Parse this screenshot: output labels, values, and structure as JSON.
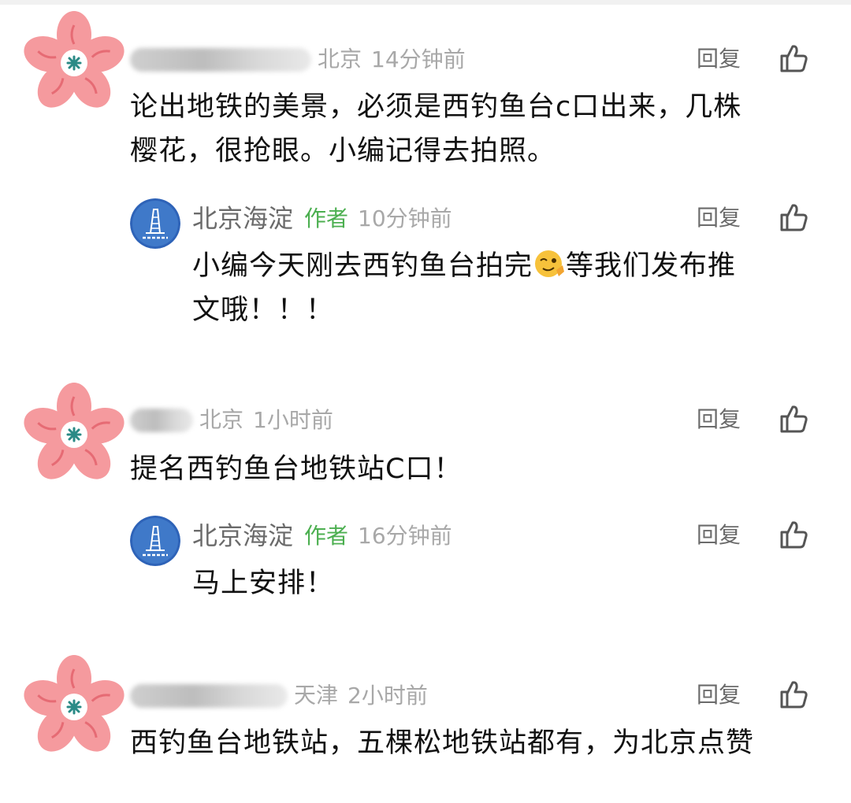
{
  "comments": [
    {
      "location": "北京",
      "time": "14分钟前",
      "text_line1": "论出地铁的美景，必须是西钓鱼台c口出来，几株",
      "text_line2": "樱花，很抢眼。小编记得去拍照。",
      "reply_label": "回复",
      "reply": {
        "name": "北京海淀",
        "tag": "作者",
        "time": "10分钟前",
        "text_line1a": "小编今天刚去西钓鱼台拍完",
        "emoji": "winking-face-emoji",
        "text_line1b": "等我们发布推",
        "text_line2": "文哦！！！",
        "reply_label": "回复"
      }
    },
    {
      "location": "北京",
      "time": "1小时前",
      "text": "提名西钓鱼台地铁站C口！",
      "reply_label": "回复",
      "reply": {
        "name": "北京海淀",
        "tag": "作者",
        "time": "16分钟前",
        "text": "马上安排！",
        "reply_label": "回复"
      }
    },
    {
      "location": "天津",
      "time": "2小时前",
      "text": "西钓鱼台地铁站，五棵松地铁站都有，为北京点赞",
      "reply_label": "回复"
    }
  ],
  "icons": {
    "like": "thumbs-up-icon",
    "avatar": "pink-flower-avatar",
    "author_avatar": "haidian-logo-avatar"
  },
  "colors": {
    "author_tag": "#4caf50",
    "meta_gray": "#a8a8a8",
    "flower_pink": "#f59a9e"
  }
}
